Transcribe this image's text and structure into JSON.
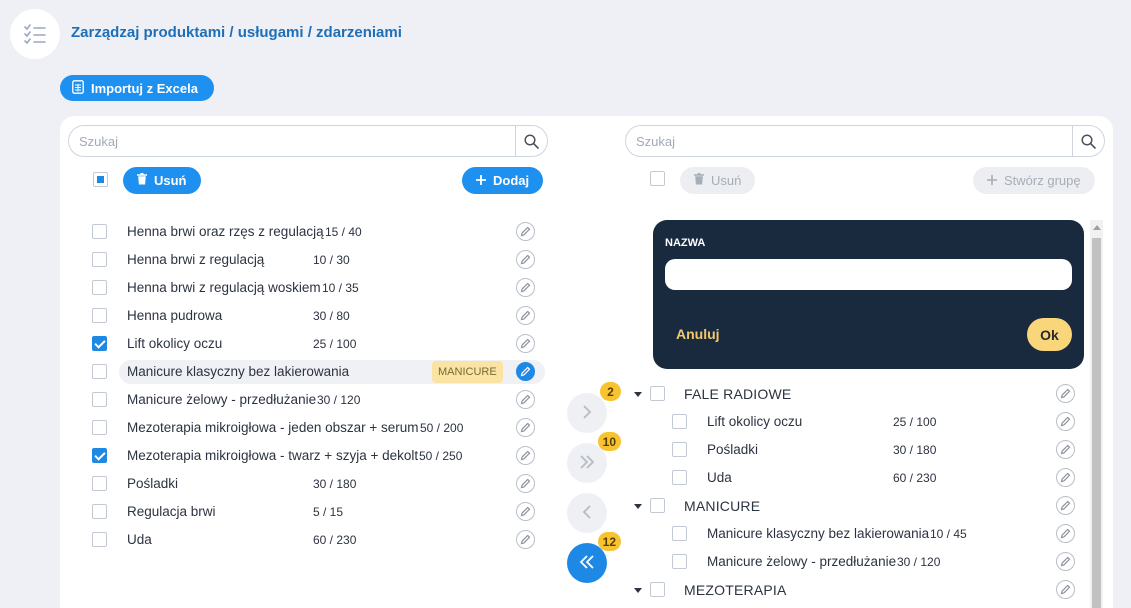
{
  "header": {
    "title": "Zarządzaj produktami / usługami / zdarzeniami"
  },
  "import_button": {
    "label": "Importuj z Excela"
  },
  "left": {
    "search_placeholder": "Szukaj",
    "delete_label": "Usuń",
    "add_label": "Dodaj",
    "select_all_state": "partial",
    "items": [
      {
        "name": "Henna brwi oraz rzęs z regulacją",
        "count": "15 / 40",
        "checked": false
      },
      {
        "name": "Henna brwi z regulacją",
        "count": "10 / 30",
        "checked": false
      },
      {
        "name": "Henna brwi z regulacją woskiem",
        "count": "10 / 35",
        "checked": false
      },
      {
        "name": "Henna pudrowa",
        "count": "30 / 80",
        "checked": false
      },
      {
        "name": "Lift okolicy oczu",
        "count": "25 / 100",
        "checked": true
      },
      {
        "name": "Manicure klasyczny bez lakierowania",
        "badge": "MANICURE",
        "checked": false,
        "highlighted": true
      },
      {
        "name": "Manicure żelowy - przedłużanie",
        "count": "30 / 120",
        "checked": false
      },
      {
        "name": "Mezoterapia mikroigłowa - jeden obszar + serum",
        "count": "50 / 200",
        "checked": false
      },
      {
        "name": "Mezoterapia mikroigłowa - twarz + szyja + dekolt",
        "count": "50 / 250",
        "checked": true
      },
      {
        "name": "Pośladki",
        "count": "30 / 180",
        "checked": false
      },
      {
        "name": "Regulacja brwi",
        "count": "5 / 15",
        "checked": false
      },
      {
        "name": "Uda",
        "count": "60 / 230",
        "checked": false
      }
    ]
  },
  "transfer": {
    "move_right_badge": "2",
    "move_all_right_badge": "10",
    "move_all_left_badge": "12"
  },
  "right": {
    "search_placeholder": "Szukaj",
    "delete_label": "Usuń",
    "create_group_label": "Stwórz grupę",
    "popover": {
      "label": "NAZWA",
      "value": "",
      "cancel_label": "Anuluj",
      "ok_label": "Ok"
    },
    "groups": [
      {
        "name": "FALE RADIOWE",
        "items": [
          {
            "name": "Lift okolicy oczu",
            "count": "25 / 100"
          },
          {
            "name": "Pośladki",
            "count": "30 / 180"
          },
          {
            "name": "Uda",
            "count": "60 / 230"
          }
        ]
      },
      {
        "name": "MANICURE",
        "items": [
          {
            "name": "Manicure klasyczny bez lakierowania",
            "count": "10 / 45"
          },
          {
            "name": "Manicure żelowy - przedłużanie",
            "count": "30 / 120"
          }
        ]
      },
      {
        "name": "MEZOTERAPIA",
        "items": []
      }
    ]
  },
  "colors": {
    "accent": "#1e90f0",
    "badge": "#f7c330",
    "popover": "#192a3f",
    "ok": "#fad67a"
  },
  "icons": [
    "checklist-icon",
    "excel-icon",
    "search-icon",
    "trash-icon",
    "plus-icon",
    "pencil-icon",
    "chevron-right-icon",
    "double-chevron-right-icon",
    "chevron-left-icon",
    "double-chevron-left-icon",
    "caret-down-icon"
  ]
}
